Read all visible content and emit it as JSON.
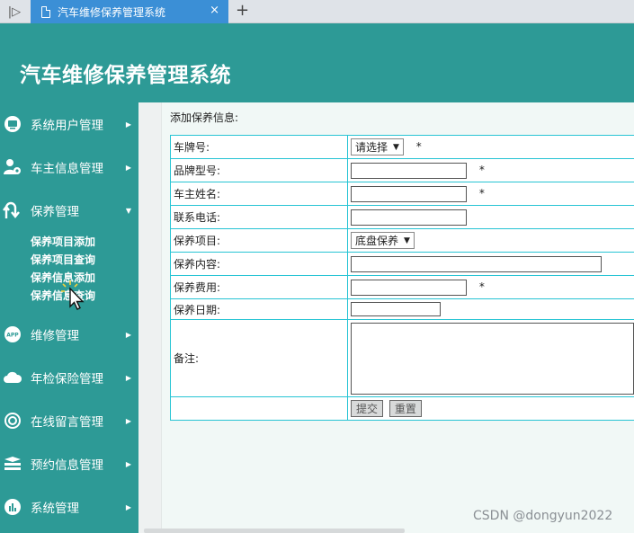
{
  "browser": {
    "sidebar_toggle": "|▷",
    "tab_title": "汽车维修保养管理系统",
    "close_glyph": "×",
    "new_tab_glyph": "+"
  },
  "header": {
    "title": "汽车维修保养管理系统"
  },
  "sidebar": {
    "items": [
      {
        "label": "系统用户管理",
        "icon": "user-monitor-icon",
        "arrow": "▶"
      },
      {
        "label": "车主信息管理",
        "icon": "user-gear-icon",
        "arrow": "▶"
      },
      {
        "label": "保养管理",
        "icon": "u-turn-icon",
        "arrow": "▼"
      },
      {
        "label": "维修管理",
        "icon": "app-icon",
        "arrow": "▶"
      },
      {
        "label": "年检保险管理",
        "icon": "cloud-icon",
        "arrow": "▶"
      },
      {
        "label": "在线留言管理",
        "icon": "settings-icon",
        "arrow": "▶"
      },
      {
        "label": "预约信息管理",
        "icon": "layers-icon",
        "arrow": "▶"
      },
      {
        "label": "系统管理",
        "icon": "chart-icon",
        "arrow": "▶"
      }
    ],
    "app_icon_text": "APP",
    "submenu": [
      "保养项目添加",
      "保养项目查询",
      "保养信息添加",
      "保养信息查询"
    ]
  },
  "form": {
    "heading": "添加保养信息:",
    "required_mark": "*",
    "fields": {
      "plate": {
        "label": "车牌号:",
        "select_value": "请选择"
      },
      "model": {
        "label": "品牌型号:"
      },
      "owner": {
        "label": "车主姓名:"
      },
      "phone": {
        "label": "联系电话:"
      },
      "item": {
        "label": "保养项目:",
        "select_value": "底盘保养"
      },
      "content": {
        "label": "保养内容:"
      },
      "fee": {
        "label": "保养费用:"
      },
      "date": {
        "label": "保养日期:"
      },
      "remark": {
        "label": "备注:"
      }
    },
    "submit_label": "提交",
    "reset_label": "重置"
  },
  "watermark": "CSDN @dongyun2022",
  "colors": {
    "primary": "#2d9a96",
    "tab_active": "#3b8fd6",
    "table_border": "#27c4d4"
  }
}
